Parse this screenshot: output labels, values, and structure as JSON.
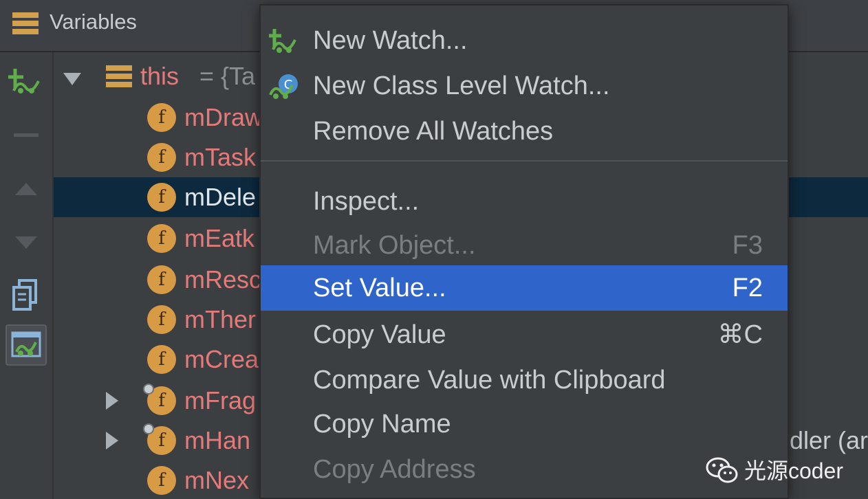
{
  "header": {
    "title": "Variables",
    "icon": "stack-frames-icon"
  },
  "toolbar": {
    "buttons": [
      {
        "name": "new-watch-icon"
      },
      {
        "name": "remove-watch-icon"
      },
      {
        "name": "move-up-icon"
      },
      {
        "name": "move-down-icon"
      },
      {
        "name": "copy-icon"
      },
      {
        "name": "show-watches-icon",
        "active": true
      }
    ]
  },
  "tree": {
    "this_row": {
      "name": "this",
      "eq": "= {Ta"
    },
    "fields": [
      {
        "badge": "f",
        "name": "mDraw"
      },
      {
        "badge": "f",
        "name": "mTask"
      },
      {
        "badge": "f",
        "name": "mDele",
        "selected": true
      },
      {
        "badge": "f",
        "name": "mEatk"
      },
      {
        "badge": "f",
        "name": "mResc"
      },
      {
        "badge": "f",
        "name": "mTher"
      },
      {
        "badge": "f",
        "name": "mCrea"
      },
      {
        "badge": "f",
        "name": "mFrag"
      },
      {
        "badge": "f",
        "name": "mHan"
      },
      {
        "badge": "f",
        "name": "mNex"
      }
    ],
    "handler_tail": "dler (ar"
  },
  "menu": {
    "items": [
      {
        "label": "New Watch...",
        "shortcut": "",
        "icon": "new-watch-icon"
      },
      {
        "label": "New Class Level Watch...",
        "shortcut": "",
        "icon": "class-level-watch-icon"
      },
      {
        "label": "Remove All Watches",
        "shortcut": ""
      },
      {
        "label": "Inspect...",
        "shortcut": ""
      },
      {
        "label": "Mark Object...",
        "shortcut": "F3",
        "disabled": true
      },
      {
        "label": "Set Value...",
        "shortcut": "F2",
        "highlight": true
      },
      {
        "label": "Copy Value",
        "shortcut": "⌘C"
      },
      {
        "label": "Compare Value with Clipboard",
        "shortcut": ""
      },
      {
        "label": "Copy Name",
        "shortcut": ""
      },
      {
        "label": "Copy Address",
        "shortcut": "",
        "disabled": true
      }
    ]
  },
  "watermark": {
    "text": "光源coder",
    "icon": "wechat-icon"
  },
  "colors": {
    "background": "#3c3f41",
    "highlight": "#2f65ca",
    "selected_row": "#0d293e",
    "field_name": "#e57a7a",
    "field_badge": "#d79a45"
  }
}
